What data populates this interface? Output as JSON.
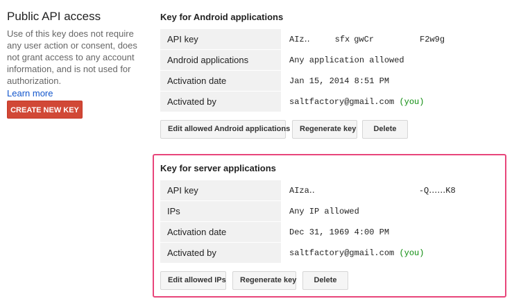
{
  "sidebar": {
    "title": "Public API access",
    "description": "Use of this key does not require any user action or consent, does not grant access to any account information, and is not used for authorization.",
    "learn_more": "Learn more",
    "create_button": "CREATE NEW KEY"
  },
  "android": {
    "title": "Key for Android applications",
    "rows": [
      {
        "label": "API key",
        "value": "AIz‥      sfx gwCr           F2w9g"
      },
      {
        "label": "Android applications",
        "value": "Any application allowed"
      },
      {
        "label": "Activation date",
        "value": "Jan 15, 2014 8:51 PM"
      },
      {
        "label": "Activated by",
        "value": "saltfactory@gmail.com",
        "you": "(you)"
      }
    ],
    "buttons": {
      "edit": "Edit allowed Android applications",
      "regenerate": "Regenerate key",
      "delete": "Delete"
    }
  },
  "server": {
    "title": "Key for server applications",
    "rows": [
      {
        "label": "API key",
        "value": "AIza‥                         -Q‥‥‥K8"
      },
      {
        "label": "IPs",
        "value": "Any IP allowed"
      },
      {
        "label": "Activation date",
        "value": "Dec 31, 1969 4:00 PM"
      },
      {
        "label": "Activated by",
        "value": "saltfactory@gmail.com",
        "you": "(you)"
      }
    ],
    "buttons": {
      "edit": "Edit allowed IPs",
      "regenerate": "Regenerate key",
      "delete": "Delete"
    }
  },
  "colors": {
    "create_button_bg": "#d14836",
    "highlight_border": "#e8457a",
    "you_text": "#0a8a0a",
    "link": "#1155cc"
  }
}
